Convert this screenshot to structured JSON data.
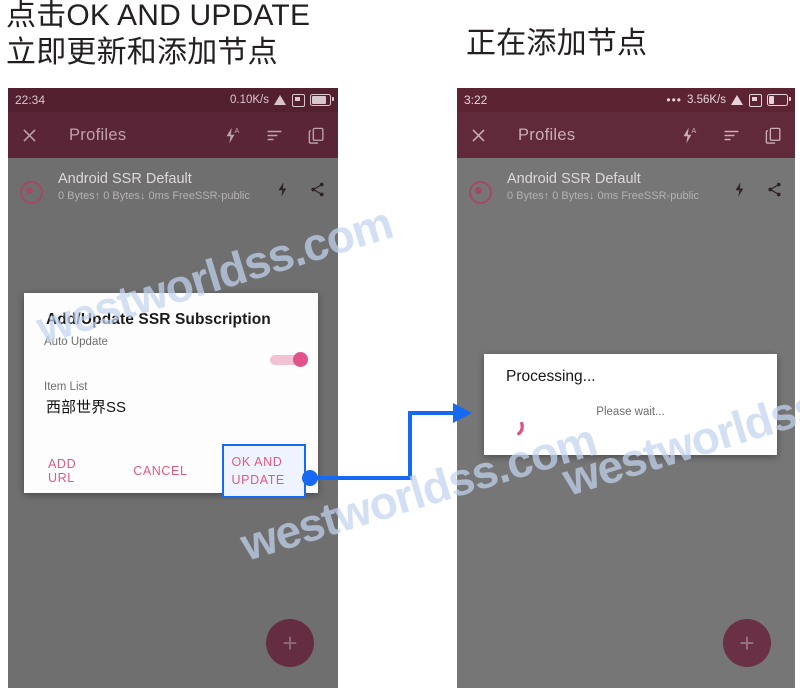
{
  "captions": {
    "left": "点击OK AND UPDATE\n立即更新和添加节点",
    "right": "正在添加节点"
  },
  "watermark": {
    "text": "westworldss.com"
  },
  "colors": {
    "appbar": "#5a2637",
    "statusbar": "#532030",
    "accent_pink": "#e2597e",
    "highlight_blue": "#1669f2",
    "fab": "#652d41"
  },
  "phone_left": {
    "status": {
      "time": "22:34",
      "speed": "0.10K/s",
      "wifi_icon": "wifi-icon",
      "screenshot_icon": "screen-record-icon",
      "battery_icon": "battery-icon"
    },
    "appbar": {
      "close_icon": "close-icon",
      "title": "Profiles",
      "flash_icon": "flash-auto-icon",
      "sort_icon": "sort-icon",
      "copy_icon": "copy-icon"
    },
    "profile": {
      "selected_icon": "radio-selected-icon",
      "title": "Android SSR Default",
      "subtitle": "0 Bytes↑  0 Bytes↓  0ms FreeSSR-public",
      "bolt_icon": "bolt-icon",
      "share_icon": "share-icon"
    },
    "fab": {
      "label": "+",
      "icon": "add-icon"
    },
    "dialog": {
      "title": "Add/Update SSR Subscription",
      "auto_update_label": "Auto Update",
      "auto_update_state": "on",
      "item_list_label": "Item List",
      "item_list_value": "西部世界SS",
      "buttons": {
        "add_url": "ADD URL",
        "cancel": "CANCEL",
        "ok_and_update": "OK AND UPDATE"
      }
    }
  },
  "phone_right": {
    "status": {
      "time": "3:22",
      "dots": "•••",
      "speed": "3.56K/s",
      "wifi_icon": "wifi-icon",
      "screenshot_icon": "screen-record-icon",
      "battery_icon": "battery-icon"
    },
    "appbar": {
      "close_icon": "close-icon",
      "title": "Profiles",
      "flash_icon": "flash-auto-icon",
      "sort_icon": "sort-icon",
      "copy_icon": "copy-icon"
    },
    "profile": {
      "selected_icon": "radio-selected-icon",
      "title": "Android SSR Default",
      "subtitle": "0 Bytes↑  0 Bytes↓  0ms FreeSSR-public",
      "bolt_icon": "bolt-icon",
      "share_icon": "share-icon"
    },
    "fab": {
      "label": "+",
      "icon": "add-icon"
    },
    "dialog": {
      "title": "Processing...",
      "message": "Please wait...",
      "spinner_icon": "loading-spinner-icon"
    }
  },
  "annotation": {
    "arrow_icon": "flow-arrow-icon"
  }
}
